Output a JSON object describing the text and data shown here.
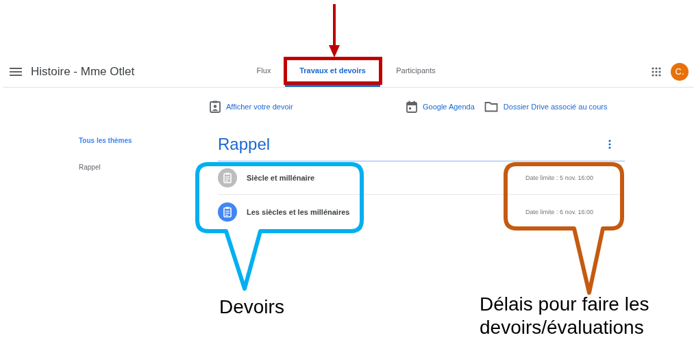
{
  "header": {
    "course_title": "Histoire - Mme Otlet",
    "avatar": "C."
  },
  "tabs": [
    {
      "label": "Flux",
      "selected": false
    },
    {
      "label": "Travaux et devoirs",
      "selected": true
    },
    {
      "label": "Participants",
      "selected": false
    }
  ],
  "toolbar": [
    {
      "kind": "work",
      "label": "Afficher votre devoir"
    },
    {
      "kind": "calendar",
      "label": "Google Agenda"
    },
    {
      "kind": "folder",
      "label": "Dossier Drive associé au cours"
    }
  ],
  "sidebar": {
    "items": [
      {
        "label": "Tous les thèmes",
        "selected": true
      },
      {
        "label": "Rappel",
        "selected": false
      }
    ]
  },
  "topic": {
    "title": "Rappel",
    "assignments": [
      {
        "title": "Siècle et millénaire",
        "due": "Date limite : 5 nov. 16:00",
        "active": false
      },
      {
        "title": "Les siècles et les millénaires",
        "due": "Date limite : 6 nov. 16:00",
        "active": true
      }
    ]
  },
  "annotations": {
    "callouts": [
      {
        "label": "Devoirs",
        "color": "#00b0f0"
      },
      {
        "label": "Délais pour faire les devoirs/évaluations",
        "color": "#c55a11"
      }
    ]
  }
}
